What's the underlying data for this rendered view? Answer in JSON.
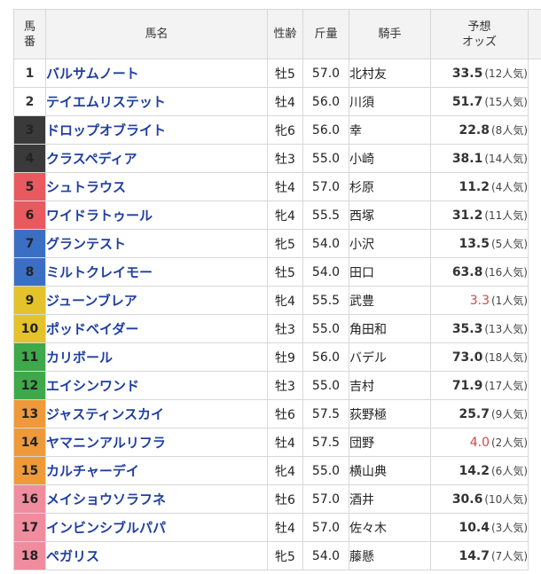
{
  "headers": {
    "num_line1": "馬",
    "num_line2": "番",
    "name": "馬名",
    "sexage": "性齢",
    "weight": "斤量",
    "jockey": "騎手",
    "odds_line1": "予想",
    "odds_line2": "オッズ"
  },
  "frame_colors": {
    "1": "#ffffff",
    "2": "#ffffff",
    "3": "#3a3a3a",
    "4": "#e85a5f",
    "5": "#3b6fc4",
    "6": "#e4c22a",
    "7": "#3ea84a",
    "8": "#ee9a3a",
    "9": "#ef8d9e"
  },
  "rows": [
    {
      "num": "1",
      "frame": 1,
      "name": "バルサムノート",
      "sexage": "牡5",
      "weight": "57.0",
      "jockey": "北村友",
      "odds": "33.5",
      "pop": "(12人気)",
      "fav": false
    },
    {
      "num": "2",
      "frame": 2,
      "name": "テイエムリステット",
      "sexage": "牡4",
      "weight": "56.0",
      "jockey": "川須",
      "odds": "51.7",
      "pop": "(15人気)",
      "fav": false
    },
    {
      "num": "3",
      "frame": 3,
      "name": "ドロップオブライト",
      "sexage": "牝6",
      "weight": "56.0",
      "jockey": "幸",
      "odds": "22.8",
      "pop": "(8人気)",
      "fav": false
    },
    {
      "num": "4",
      "frame": 3,
      "name": "クラスペディア",
      "sexage": "牡3",
      "weight": "55.0",
      "jockey": "小崎",
      "odds": "38.1",
      "pop": "(14人気)",
      "fav": false
    },
    {
      "num": "5",
      "frame": 4,
      "name": "シュトラウス",
      "sexage": "牡4",
      "weight": "57.0",
      "jockey": "杉原",
      "odds": "11.2",
      "pop": "(4人気)",
      "fav": false
    },
    {
      "num": "6",
      "frame": 4,
      "name": "ワイドラトゥール",
      "sexage": "牝4",
      "weight": "55.5",
      "jockey": "西塚",
      "odds": "31.2",
      "pop": "(11人気)",
      "fav": false
    },
    {
      "num": "7",
      "frame": 5,
      "name": "グランテスト",
      "sexage": "牝5",
      "weight": "54.0",
      "jockey": "小沢",
      "odds": "13.5",
      "pop": "(5人気)",
      "fav": false
    },
    {
      "num": "8",
      "frame": 5,
      "name": "ミルトクレイモー",
      "sexage": "牡5",
      "weight": "54.0",
      "jockey": "田口",
      "odds": "63.8",
      "pop": "(16人気)",
      "fav": false
    },
    {
      "num": "9",
      "frame": 6,
      "name": "ジューンブレア",
      "sexage": "牝4",
      "weight": "55.5",
      "jockey": "武豊",
      "odds": "3.3",
      "pop": "(1人気)",
      "fav": true
    },
    {
      "num": "10",
      "frame": 6,
      "name": "ポッドベイダー",
      "sexage": "牡3",
      "weight": "55.0",
      "jockey": "角田和",
      "odds": "35.3",
      "pop": "(13人気)",
      "fav": false
    },
    {
      "num": "11",
      "frame": 7,
      "name": "カリボール",
      "sexage": "牡9",
      "weight": "56.0",
      "jockey": "バデル",
      "odds": "73.0",
      "pop": "(18人気)",
      "fav": false
    },
    {
      "num": "12",
      "frame": 7,
      "name": "エイシンワンド",
      "sexage": "牡3",
      "weight": "55.0",
      "jockey": "吉村",
      "odds": "71.9",
      "pop": "(17人気)",
      "fav": false
    },
    {
      "num": "13",
      "frame": 8,
      "name": "ジャスティンスカイ",
      "sexage": "牡6",
      "weight": "57.5",
      "jockey": "荻野極",
      "odds": "25.7",
      "pop": "(9人気)",
      "fav": false
    },
    {
      "num": "14",
      "frame": 8,
      "name": "ヤマニンアルリフラ",
      "sexage": "牡4",
      "weight": "57.5",
      "jockey": "団野",
      "odds": "4.0",
      "pop": "(2人気)",
      "fav": true
    },
    {
      "num": "15",
      "frame": 8,
      "name": "カルチャーデイ",
      "sexage": "牝4",
      "weight": "55.0",
      "jockey": "横山典",
      "odds": "14.2",
      "pop": "(6人気)",
      "fav": false
    },
    {
      "num": "16",
      "frame": 9,
      "name": "メイショウソラフネ",
      "sexage": "牡6",
      "weight": "57.0",
      "jockey": "酒井",
      "odds": "30.6",
      "pop": "(10人気)",
      "fav": false
    },
    {
      "num": "17",
      "frame": 9,
      "name": "インビンシブルパパ",
      "sexage": "牡4",
      "weight": "57.0",
      "jockey": "佐々木",
      "odds": "10.4",
      "pop": "(3人気)",
      "fav": false
    },
    {
      "num": "18",
      "frame": 9,
      "name": "ペガリス",
      "sexage": "牝5",
      "weight": "54.0",
      "jockey": "藤懸",
      "odds": "14.7",
      "pop": "(7人気)",
      "fav": false
    }
  ]
}
